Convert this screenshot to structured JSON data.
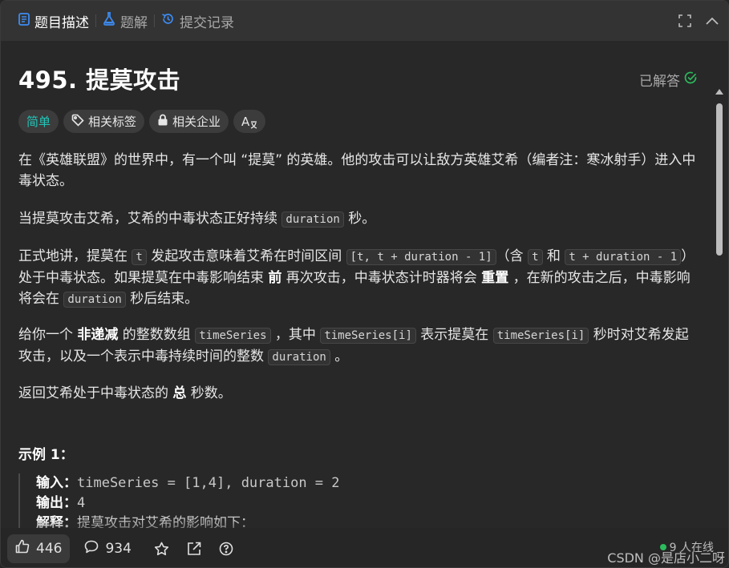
{
  "tabs": [
    {
      "label": "题目描述",
      "active": true,
      "icon": "document-icon"
    },
    {
      "label": "题解",
      "active": false,
      "icon": "flask-icon"
    },
    {
      "label": "提交记录",
      "active": false,
      "icon": "history-icon"
    }
  ],
  "problem": {
    "title": "495. 提莫攻击",
    "status": "已解答",
    "tags": {
      "difficulty": "简单",
      "related_tags": "相关标签",
      "related_companies": "相关企业",
      "translate": "A"
    }
  },
  "description": {
    "p1": "在《英雄联盟》的世界中，有一个叫 “提莫” 的英雄。他的攻击可以让敌方英雄艾希（编者注：寒冰射手）进入中毒状态。",
    "p2_a": "当提莫攻击艾希，艾希的中毒状态正好持续 ",
    "p2_code": "duration",
    "p2_b": " 秒。",
    "p3_a": "正式地讲，提莫在 ",
    "p3_code1": "t",
    "p3_b": " 发起攻击意味着艾希在时间区间 ",
    "p3_code2": "[t, t + duration - 1]",
    "p3_c": "（含 ",
    "p3_code3": "t",
    "p3_d": " 和 ",
    "p3_code4": "t + duration - 1",
    "p3_e": "）处于中毒状态。如果提莫在中毒影响结束 ",
    "p3_bold1": "前",
    "p3_f": " 再次攻击，中毒状态计时器将会 ",
    "p3_bold2": "重置",
    "p3_g": " ，在新的攻击之后，中毒影响将会在 ",
    "p3_code5": "duration",
    "p3_h": " 秒后结束。",
    "p4_a": "给你一个 ",
    "p4_bold": "非递减",
    "p4_b": " 的整数数组 ",
    "p4_code1": "timeSeries",
    "p4_c": " ，其中 ",
    "p4_code2": "timeSeries[i]",
    "p4_d": " 表示提莫在 ",
    "p4_code3": "timeSeries[i]",
    "p4_e": " 秒时对艾希发起攻击，以及一个表示中毒持续时间的整数 ",
    "p4_code4": "duration",
    "p4_f": " 。",
    "p5_a": "返回艾希处于中毒状态的 ",
    "p5_bold": "总",
    "p5_b": " 秒数。"
  },
  "example": {
    "title": "示例 1：",
    "input_label": "输入：",
    "input_value": "timeSeries = [1,4], duration = 2",
    "output_label": "输出：",
    "output_value": "4",
    "explain_label": "解释：",
    "explain_value": "提莫攻击对艾希的影响如下："
  },
  "footer": {
    "likes": "446",
    "comments": "934",
    "online": "9 人在线",
    "watermark": "CSDN @是店小二呀"
  },
  "colors": {
    "accent_easy": "#22c5b8",
    "solved_check": "#2cbb5d",
    "tab_icon_blue": "#3d8bf2"
  }
}
